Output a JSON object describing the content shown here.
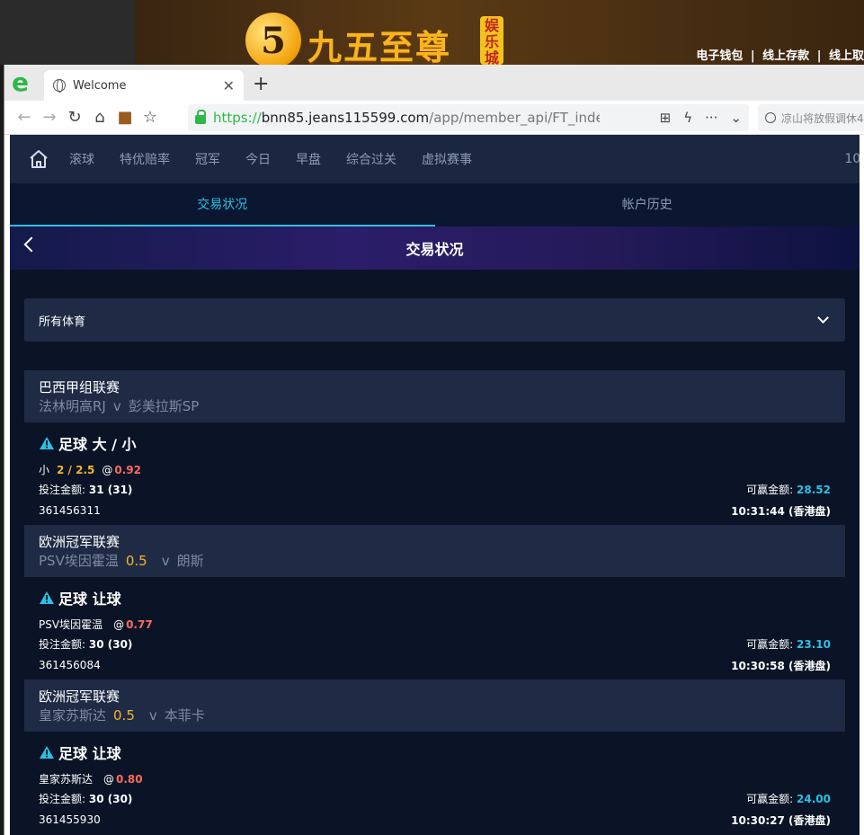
{
  "banner": {
    "logo_digit": "5",
    "logo_text": "九五至尊",
    "logo_badge": [
      "娱",
      "乐",
      "城"
    ],
    "links": [
      "电子钱包",
      "|",
      "线上存款",
      "|",
      "线上取"
    ]
  },
  "browser": {
    "tab_title": "Welcome",
    "url_scheme": "https://",
    "url_host": "bnn85.jeans115599.com",
    "url_path": "/app/member_api/FT_index.php?mt",
    "search_placeholder": "凉山将放假调休4"
  },
  "nav": {
    "items": [
      "滚球",
      "特优赔率",
      "冠军",
      "今日",
      "早盘",
      "综合过关",
      "虚拟赛事"
    ],
    "time": "10:"
  },
  "subtabs": [
    "交易状况",
    "帐户历史"
  ],
  "title": "交易状况",
  "filter": {
    "selected": "所有体育"
  },
  "labels": {
    "stake": "投注金额: ",
    "win": "可赢金额: "
  },
  "bets": [
    {
      "league": "巴西甲组联赛",
      "home": "法林明高RJ",
      "handicap": "",
      "vs": "v",
      "away": "彭美拉斯SP",
      "market": "足球 大 / 小",
      "selection": "小",
      "line": "2 / 2.5",
      "odds": "0.92",
      "stake": "31 (31)",
      "win": "28.52",
      "ticket": "361456311",
      "time": "10:31:44 (香港盘)"
    },
    {
      "league": "欧洲冠军联赛",
      "home": "PSV埃因霍温",
      "handicap": "0.5",
      "vs": "v",
      "away": "朗斯",
      "market": "足球 让球",
      "selection": "PSV埃因霍温",
      "line": "",
      "odds": "0.77",
      "stake": "30 (30)",
      "win": "23.10",
      "ticket": "361456084",
      "time": "10:30:58 (香港盘)"
    },
    {
      "league": "欧洲冠军联赛",
      "home": "皇家苏斯达",
      "handicap": "0.5",
      "vs": "v",
      "away": "本菲卡",
      "market": "足球 让球",
      "selection": "皇家苏斯达",
      "line": "",
      "odds": "0.80",
      "stake": "30 (30)",
      "win": "24.00",
      "ticket": "361455930",
      "time": "10:30:27 (香港盘)"
    }
  ]
}
